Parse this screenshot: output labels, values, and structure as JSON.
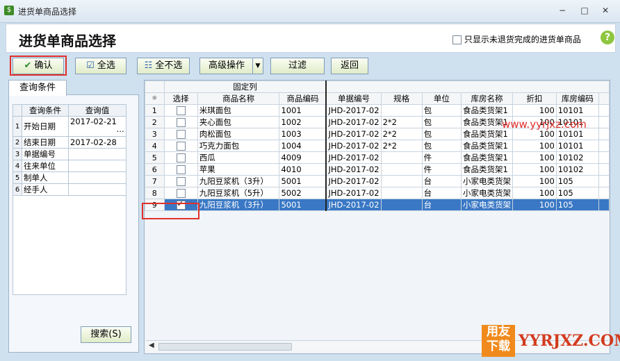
{
  "window": {
    "title": "进货单商品选择",
    "minimize": "−",
    "maximize": "□",
    "close": "✕"
  },
  "header": {
    "title": "进货单商品选择",
    "checkbox_label": "只显示未退货完成的进货单商品",
    "help": "?"
  },
  "toolbar": {
    "confirm": "确认",
    "select_all": "全选",
    "select_none": "全不选",
    "advanced": "高级操作",
    "filter": "过滤",
    "back": "返回"
  },
  "left": {
    "tab": "查询条件",
    "columns": [
      "查询条件",
      "查询值"
    ],
    "rows": [
      {
        "n": "1",
        "cond": "开始日期",
        "val": "2017-02-21"
      },
      {
        "n": "2",
        "cond": "结束日期",
        "val": "2017-02-28"
      },
      {
        "n": "3",
        "cond": "单据编号",
        "val": ""
      },
      {
        "n": "4",
        "cond": "往来单位",
        "val": ""
      },
      {
        "n": "5",
        "cond": "制单人",
        "val": ""
      },
      {
        "n": "6",
        "cond": "经手人",
        "val": ""
      }
    ],
    "search_button": "搜索(S)"
  },
  "grid": {
    "fixed_label": "固定列",
    "columns": [
      "选择",
      "商品名称",
      "商品编码",
      "单据编号",
      "规格",
      "单位",
      "库房名称",
      "折扣",
      "库房编码"
    ],
    "corner": "❄",
    "rows": [
      {
        "n": "1",
        "checked": false,
        "name": "米琪面包",
        "code": "1001",
        "bill": "JHD-2017-02",
        "spec": "",
        "unit": "包",
        "store": "食品类货架1",
        "disc": "100",
        "scode": "10101"
      },
      {
        "n": "2",
        "checked": false,
        "name": "夹心面包",
        "code": "1002",
        "bill": "JHD-2017-02",
        "spec": "2*2",
        "unit": "包",
        "store": "食品类货架1",
        "disc": "100",
        "scode": "10101"
      },
      {
        "n": "3",
        "checked": false,
        "name": "肉松面包",
        "code": "1003",
        "bill": "JHD-2017-02",
        "spec": "2*2",
        "unit": "包",
        "store": "食品类货架1",
        "disc": "100",
        "scode": "10101"
      },
      {
        "n": "4",
        "checked": false,
        "name": "巧克力面包",
        "code": "1004",
        "bill": "JHD-2017-02",
        "spec": "2*2",
        "unit": "包",
        "store": "食品类货架1",
        "disc": "100",
        "scode": "10101"
      },
      {
        "n": "5",
        "checked": false,
        "name": "西瓜",
        "code": "4009",
        "bill": "JHD-2017-02",
        "spec": "",
        "unit": "件",
        "store": "食品类货架1",
        "disc": "100",
        "scode": "10102"
      },
      {
        "n": "6",
        "checked": false,
        "name": "苹果",
        "code": "4010",
        "bill": "JHD-2017-02",
        "spec": "",
        "unit": "件",
        "store": "食品类货架1",
        "disc": "100",
        "scode": "10102"
      },
      {
        "n": "7",
        "checked": false,
        "name": "九阳豆浆机（3升）",
        "code": "5001",
        "bill": "JHD-2017-02",
        "spec": "",
        "unit": "台",
        "store": "小家电类货架",
        "disc": "100",
        "scode": "105"
      },
      {
        "n": "8",
        "checked": false,
        "name": "九阳豆浆机（5升）",
        "code": "5002",
        "bill": "JHD-2017-02",
        "spec": "",
        "unit": "台",
        "store": "小家电类货架",
        "disc": "100",
        "scode": "105"
      },
      {
        "n": "9",
        "checked": true,
        "name": "九阳豆浆机（3升）",
        "code": "5001",
        "bill": "JHD-2017-02",
        "spec": "",
        "unit": "台",
        "store": "小家电类货架",
        "disc": "100",
        "scode": "105"
      }
    ]
  },
  "watermark": {
    "url": "www.yyrjxz.com",
    "logo_top": "用友",
    "logo_bottom": "下载",
    "domain": "YYRJXZ.COM"
  }
}
